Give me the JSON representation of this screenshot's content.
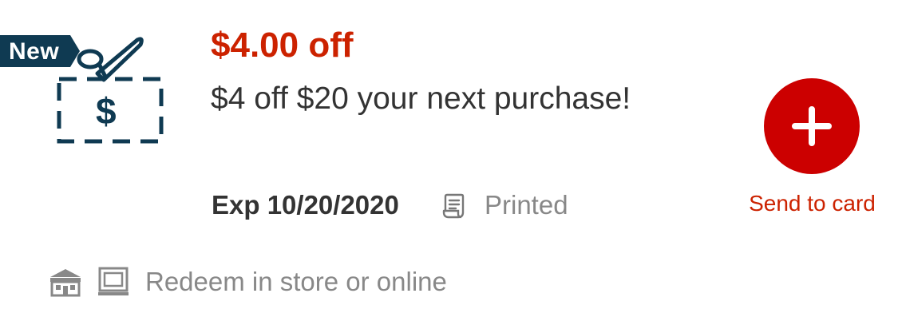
{
  "coupon": {
    "badge": "New",
    "icon_symbol": "$",
    "title": "$4.00 off",
    "description": "$4 off $20 your next purchase!",
    "expiration": "Exp 10/20/2020",
    "status": "Printed",
    "redeem": "Redeem in store or online"
  },
  "action": {
    "send_label": "Send to card"
  },
  "icons": {
    "coupon": "coupon-scissors-icon",
    "receipt": "receipt-icon",
    "store": "store-icon",
    "online": "online-screen-icon",
    "add": "plus-icon"
  },
  "colors": {
    "accent_red": "#cc0000",
    "title_red": "#cc2200",
    "navy": "#0f3a52",
    "text_dark": "#333333",
    "text_muted": "#888888"
  }
}
